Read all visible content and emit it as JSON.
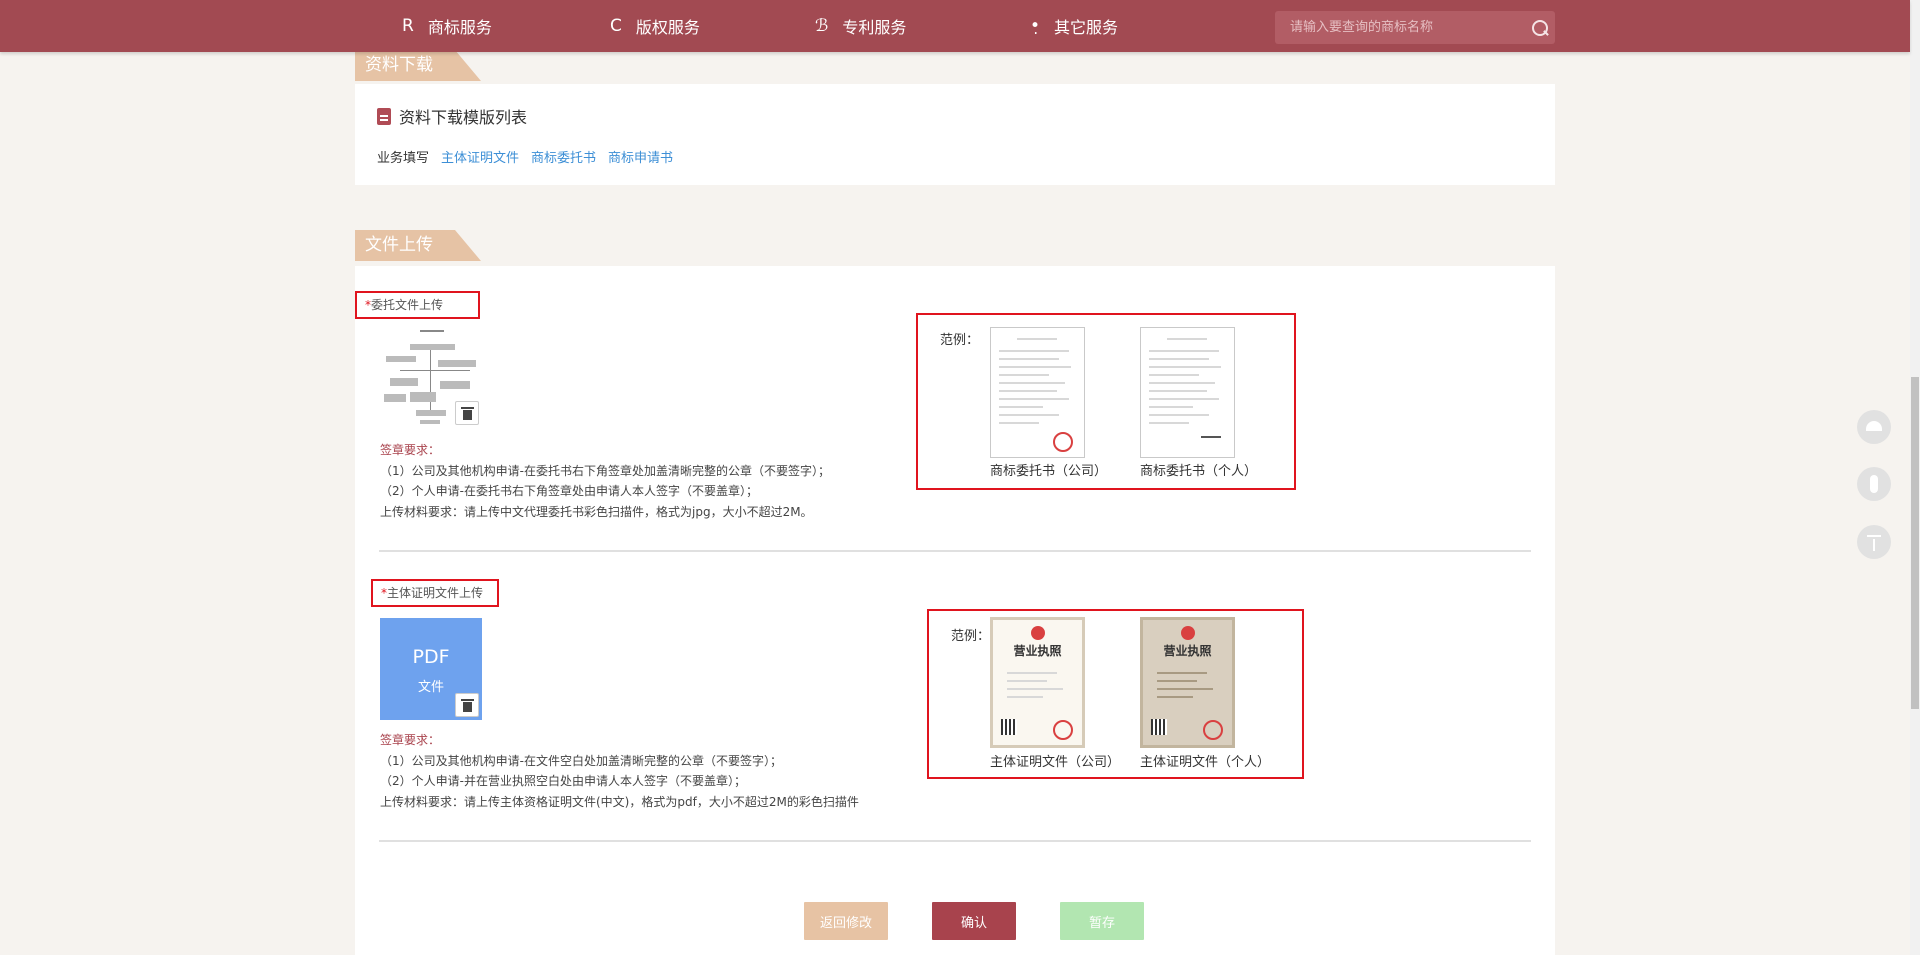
{
  "nav": {
    "items": [
      {
        "icon": "R",
        "label": "商标服务"
      },
      {
        "icon": "C",
        "label": "版权服务"
      },
      {
        "icon": "ℬ",
        "label": "专利服务"
      },
      {
        "icon": "•̣",
        "label": "其它服务"
      }
    ],
    "search_placeholder": "请输入要查询的商标名称"
  },
  "download": {
    "section_title": "资料下载",
    "list_title": "资料下载模版列表",
    "row_label": "业务填写",
    "links": [
      "主体证明文件",
      "商标委托书",
      "商标申请书"
    ]
  },
  "upload": {
    "section_title": "文件上传",
    "example_label": "范例：",
    "delegation": {
      "star": "*",
      "label": "委托文件上传",
      "req_title": "签章要求：",
      "notes": [
        "（1）公司及其他机构申请-在委托书右下角签章处加盖清晰完整的公章（不要签字）；",
        "（2）个人申请-在委托书右下角签章处由申请人本人签字（不要盖章）；",
        "上传材料要求：请上传中文代理委托书彩色扫描件，格式为jpg，大小不超过2M。"
      ],
      "examples": [
        "商标委托书（公司）",
        "商标委托书（个人）"
      ]
    },
    "identity": {
      "star": "*",
      "label": "主体证明文件上传",
      "pdf_text": "PDF",
      "pdf_sub": "文件",
      "req_title": "签章要求：",
      "notes": [
        "（1）公司及其他机构申请-在文件空白处加盖清晰完整的公章（不要签字）；",
        "（2）个人申请-并在营业执照空白处由申请人本人签字（不要盖章）；",
        "上传材料要求：请上传主体资格证明文件(中文)，格式为pdf，大小不超过2M的彩色扫描件"
      ],
      "license_title": "营业执照",
      "examples": [
        "主体证明文件（公司）",
        "主体证明文件（个人）"
      ]
    }
  },
  "buttons": {
    "back": "返回修改",
    "confirm": "确认",
    "draft": "暂存"
  },
  "colors": {
    "nav_bg": "#a24a52",
    "tag_bg": "#e6c3a5",
    "link": "#3d8fd6",
    "highlight_border": "#e0141e"
  }
}
